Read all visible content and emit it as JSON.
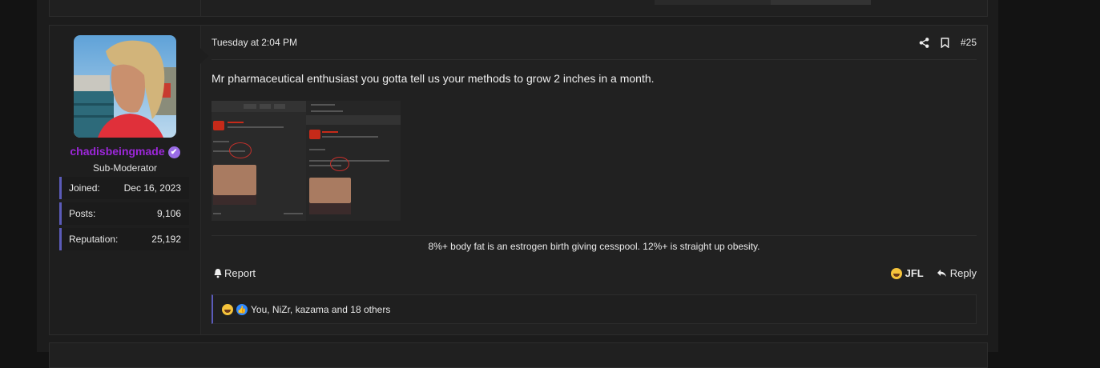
{
  "post": {
    "date": "Tuesday at 2:04 PM",
    "number": "#25",
    "body": "Mr pharmaceutical enthusiast you gotta tell us your methods to grow 2 inches in a month.",
    "signature": "8%+ body fat is an estrogen birth giving cesspool. 12%+ is straight up obesity.",
    "report_label": "Report",
    "jfl_label": "JFL",
    "reply_label": "Reply",
    "reactions_text": "You, NiZr, kazama and 18 others"
  },
  "user": {
    "name": "chadisbeingmade",
    "title": "Sub-Moderator",
    "stats": [
      {
        "key": "Joined:",
        "value": "Dec 16, 2023"
      },
      {
        "key": "Posts:",
        "value": "9,106"
      },
      {
        "key": "Reputation:",
        "value": "25,192"
      }
    ]
  },
  "icons": {
    "share": "share-icon",
    "bookmark": "bookmark-icon",
    "report": "bell-icon",
    "jfl": "laughing-emoji-icon",
    "reply": "reply-arrow-icon",
    "verified": "verified-badge-icon"
  },
  "colors": {
    "username": "#9c27d9",
    "accent_bar": "#5b5bb9",
    "background": "#131313",
    "post_bg": "#212121"
  }
}
